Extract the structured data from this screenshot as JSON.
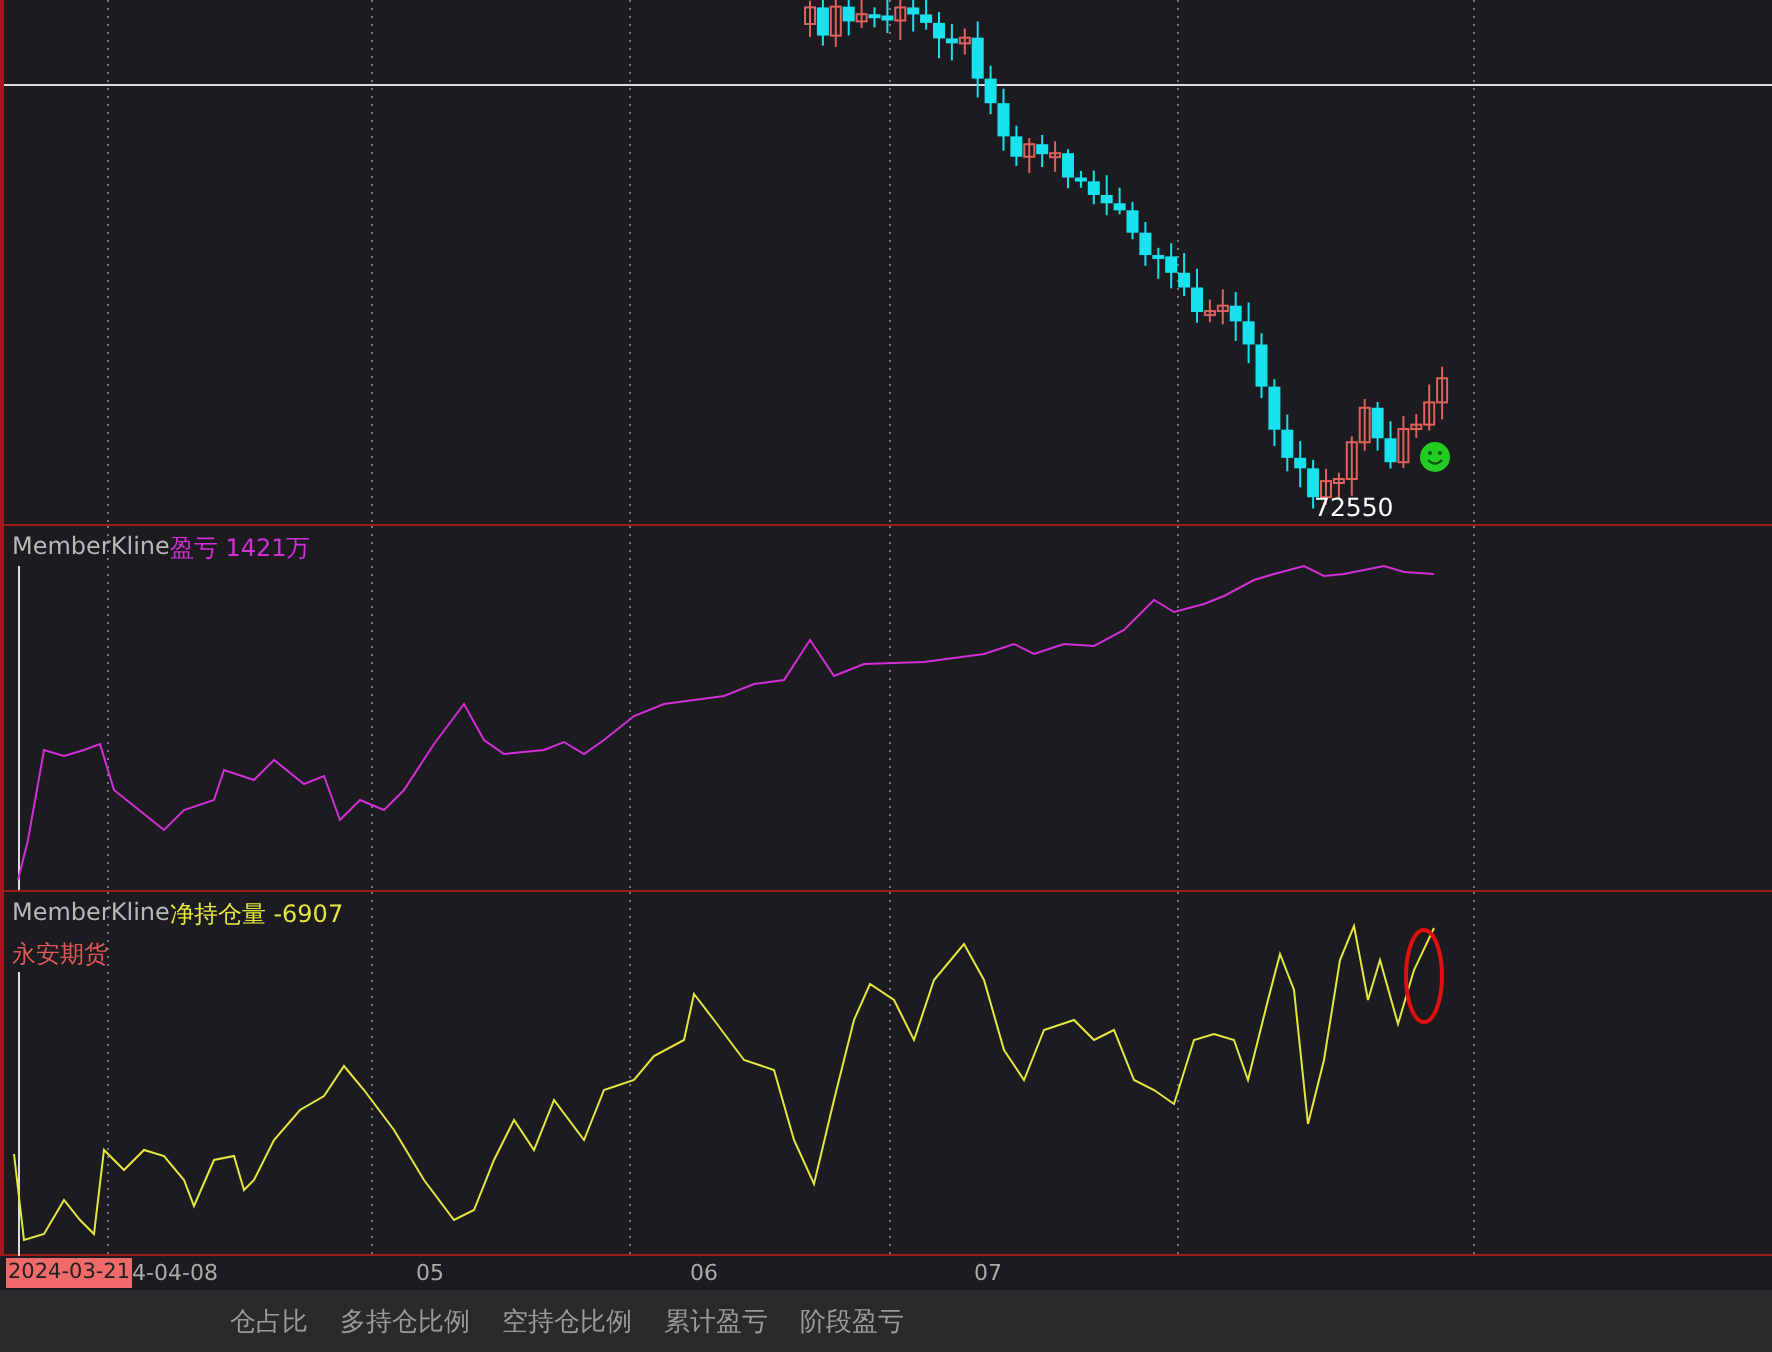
{
  "chart": {
    "price_label": "72550",
    "indicators": [
      {
        "source": "MemberKline",
        "name": "盈亏 1421万",
        "color": "#d22fd8"
      },
      {
        "source": "MemberKline",
        "name": "净持仓量 -6907",
        "color": "#e6e640",
        "member": "永安期货"
      }
    ]
  },
  "time_axis": {
    "cursor_date": "2024-03-21",
    "labels": [
      "4-04-08",
      "05",
      "06",
      "07"
    ]
  },
  "tabs": [
    {
      "label": "仓占比",
      "selected": false
    },
    {
      "label": "多持仓比例",
      "selected": false
    },
    {
      "label": "空持仓比例",
      "selected": false
    },
    {
      "label": "累计盈亏",
      "selected": false
    },
    {
      "label": "阶段盈亏",
      "selected": false
    }
  ]
}
